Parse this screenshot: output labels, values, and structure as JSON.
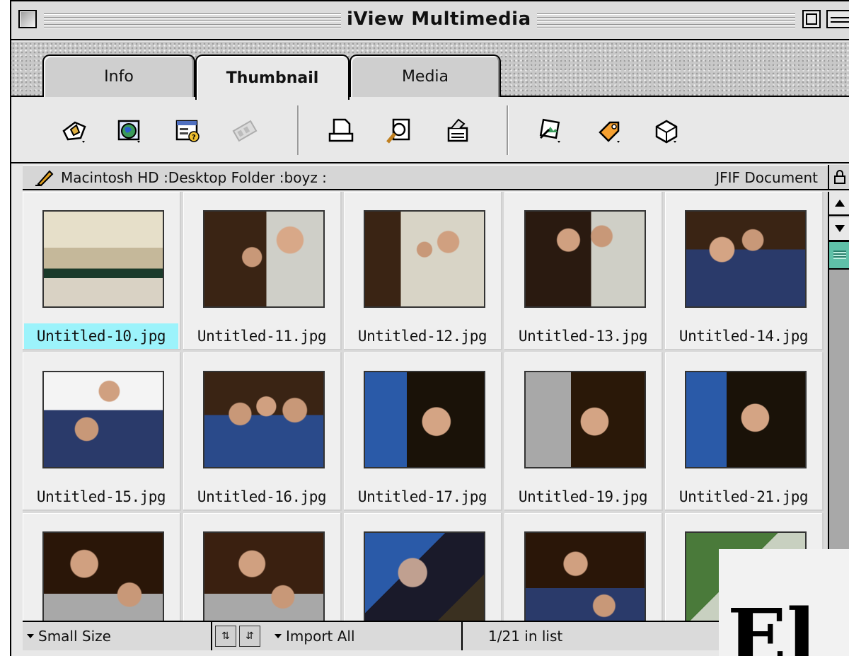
{
  "window": {
    "title": "iView Multimedia"
  },
  "tabs": [
    {
      "label": "Info",
      "active": false
    },
    {
      "label": "Thumbnail",
      "active": true
    },
    {
      "label": "Media",
      "active": false
    }
  ],
  "toolbar": {
    "icons": [
      "set-icon-icon",
      "web-export-icon",
      "catalog-info-icon",
      "slideshow-icon",
      "print-icon",
      "magnify-icon",
      "open-app-icon",
      "import-icon",
      "label-icon",
      "script-icon"
    ]
  },
  "pathbar": {
    "path": "Macintosh HD :Desktop Folder :boyz :",
    "doc_type": "JFIF Document"
  },
  "thumbnails": [
    {
      "name": "Untitled-10.jpg",
      "selected": true
    },
    {
      "name": "Untitled-11.jpg",
      "selected": false
    },
    {
      "name": "Untitled-12.jpg",
      "selected": false
    },
    {
      "name": "Untitled-13.jpg",
      "selected": false
    },
    {
      "name": "Untitled-14.jpg",
      "selected": false
    },
    {
      "name": "Untitled-15.jpg",
      "selected": false
    },
    {
      "name": "Untitled-16.jpg",
      "selected": false
    },
    {
      "name": "Untitled-17.jpg",
      "selected": false
    },
    {
      "name": "Untitled-19.jpg",
      "selected": false
    },
    {
      "name": "Untitled-21.jpg",
      "selected": false
    }
  ],
  "statusbar": {
    "size_label": "Small Size",
    "import_label": "Import All",
    "count_label": "1/21 in list"
  },
  "overlay": {
    "text": "El"
  },
  "colors": {
    "selection": "#9cf3fb",
    "scroll_thumb": "#5fc0a8"
  }
}
